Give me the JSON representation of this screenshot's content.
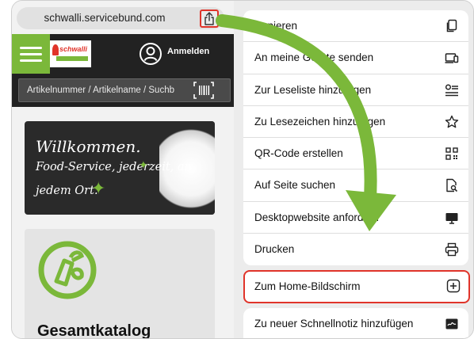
{
  "browser": {
    "url": "schwalli.servicebund.com",
    "logo_text": "schwalli",
    "login_label": "Anmelden",
    "search_placeholder": "Artikelnummer / Artikelname / Suchb"
  },
  "welcome": {
    "line1": "Willkommen.",
    "line2": "Food-Service, jederzeit, an",
    "line3": "jedem Ort."
  },
  "catalog": {
    "title": "Gesamtkatalog"
  },
  "share_sheet": {
    "items": [
      {
        "label": "Kopieren",
        "icon": "copy-icon"
      },
      {
        "label": "An meine Geräte senden",
        "icon": "devices-icon"
      },
      {
        "label": "Zur Leseliste hinzufügen",
        "icon": "reading-list-icon"
      },
      {
        "label": "Zu Lesezeichen hinzufügen",
        "icon": "star-icon"
      },
      {
        "label": "QR-Code erstellen",
        "icon": "qr-code-icon"
      },
      {
        "label": "Auf Seite suchen",
        "icon": "find-on-page-icon"
      },
      {
        "label": "Desktopwebsite anfordern",
        "icon": "desktop-icon"
      },
      {
        "label": "Drucken",
        "icon": "print-icon"
      }
    ],
    "highlighted": {
      "label": "Zum Home-Bildschirm",
      "icon": "add-square-icon"
    },
    "last": {
      "label": "Zu neuer Schnellnotiz hinzufügen",
      "icon": "quick-note-icon"
    }
  },
  "colors": {
    "accent_green": "#7bb83a",
    "highlight_red": "#e0342a",
    "header_dark": "#222222"
  }
}
